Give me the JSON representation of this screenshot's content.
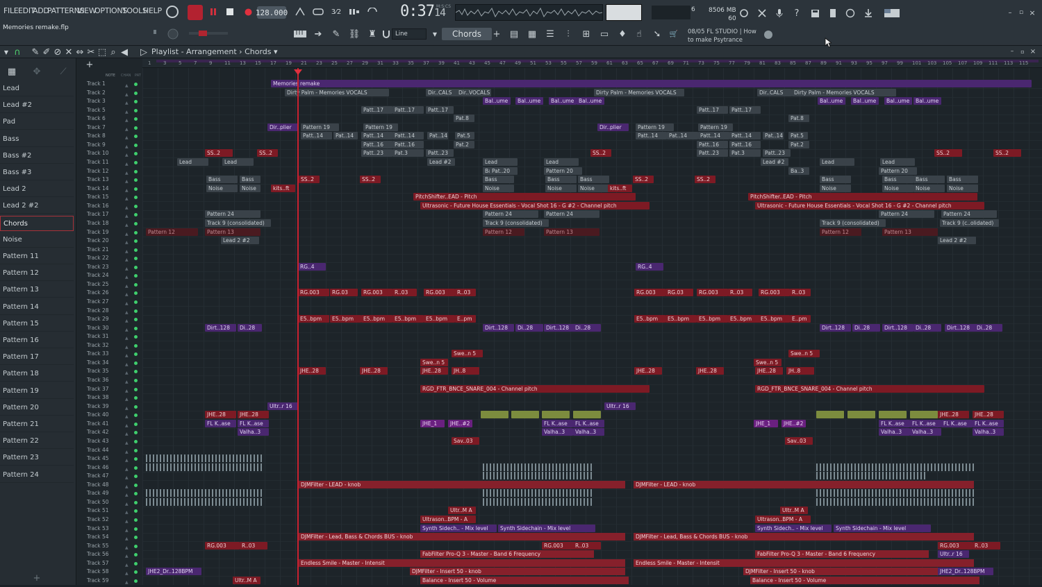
{
  "menu": [
    "FILE",
    "EDIT",
    "ADD",
    "PATTERNS",
    "VIEW",
    "OPTIONS",
    "TOOLS",
    "HELP"
  ],
  "transport": {
    "tempo": "128.000",
    "time": "0:37",
    "time_small": "14",
    "msc": "M:S:CS"
  },
  "monitor": {
    "cpu": "6",
    "memory": "8506 MB",
    "poly": "60"
  },
  "hint": {
    "line1": "08/05  FL STUDIO | How",
    "line2": "to make Psytrance"
  },
  "project": {
    "filename": "Memories remake.flp"
  },
  "toolbar": {
    "snap": "Line",
    "pattern": "Chords"
  },
  "playlist": {
    "breadcrumb": "Playlist - Arrangement",
    "current": "Chords"
  },
  "channels": [
    {
      "label": "Lead"
    },
    {
      "label": "Lead #2"
    },
    {
      "label": "Pad"
    },
    {
      "label": "Bass"
    },
    {
      "label": "Bass #2"
    },
    {
      "label": "Bass #3"
    },
    {
      "label": "Lead 2"
    },
    {
      "label": "Lead 2 #2"
    },
    {
      "label": "Chords"
    },
    {
      "label": "Noise"
    },
    {
      "label": "Pattern 11"
    },
    {
      "label": "Pattern 12"
    },
    {
      "label": "Pattern 13"
    },
    {
      "label": "Pattern 14"
    },
    {
      "label": "Pattern 15"
    },
    {
      "label": "Pattern 16"
    },
    {
      "label": "Pattern 17"
    },
    {
      "label": "Pattern 18"
    },
    {
      "label": "Pattern 19"
    },
    {
      "label": "Pattern 20"
    },
    {
      "label": "Pattern 21"
    },
    {
      "label": "Pattern 22"
    },
    {
      "label": "Pattern 23"
    },
    {
      "label": "Pattern 24"
    }
  ],
  "tracks": [
    "Track 1",
    "Track 2",
    "Track 3",
    "Track 5",
    "Track 6",
    "Track 7",
    "Track 8",
    "Track 9",
    "Track 10",
    "Track 11",
    "Track 12",
    "Track 13",
    "Track 14",
    "Track 15",
    "Track 16",
    "Track 17",
    "Track 18",
    "Track 19",
    "Track 20",
    "Track 21",
    "Track 22",
    "Track 23",
    "Track 24",
    "Track 25",
    "Track 26",
    "Track 27",
    "Track 28",
    "Track 29",
    "Track 30",
    "Track 31",
    "Track 32",
    "Track 33",
    "Track 34",
    "Track 35",
    "Track 36",
    "Track 37",
    "Track 38",
    "Track 39",
    "Track 40",
    "Track 41",
    "Track 42",
    "Track 43",
    "Track 44",
    "Track 45",
    "Track 46",
    "Track 47",
    "Track 48",
    "Track 49",
    "Track 50",
    "Track 51",
    "Track 52",
    "Track 53",
    "Track 54",
    "Track 55",
    "Track 56",
    "Track 57",
    "Track 58",
    "Track 59"
  ],
  "ruler": [
    "1",
    "3",
    "5",
    "7",
    "9",
    "11",
    "13",
    "15",
    "17",
    "19",
    "21",
    "23",
    "25",
    "27",
    "29",
    "31",
    "33",
    "35",
    "37",
    "39",
    "41",
    "43",
    "45",
    "47",
    "49",
    "51",
    "53",
    "55",
    "57",
    "59",
    "61",
    "63",
    "65",
    "67",
    "69",
    "71",
    "73",
    "75",
    "77",
    "79",
    "81",
    "83",
    "85",
    "87",
    "89",
    "91",
    "93",
    "95",
    "97",
    "99",
    "101",
    "103",
    "105",
    "107",
    "109",
    "111",
    "113",
    "115"
  ],
  "clips": {
    "memories": "Memories remake",
    "dirty_palm": "Dirty Palm - Memories VOCALS",
    "dir_cals": "Dir..CALS",
    "dir_vocals": "Dir..VOCALS",
    "dirty_palm2": "Dirty Palm - Memories VOCALS",
    "dir_cals2": "Dir..CALS",
    "dirty_palm3": "Dirty Palm - Memories VOCALS",
    "bal_ume": "Bal..ume",
    "patt17": "Patt..17",
    "pat8": "Pat.8",
    "pattern19": "Pattern 19",
    "dir_plier": "Dir..plier",
    "patt14": "Patt..14",
    "pat14": "Pat..14",
    "pat5": "Pat.5",
    "patt16": "Patt..16",
    "pat16": "Pat..16",
    "pat2": "Pat.2",
    "ss2": "SS..2",
    "patt23": "Patt..23",
    "pat3": "Pat.3",
    "lead": "Lead",
    "lead2": "Lead #2",
    "pattern20": "Pattern 20",
    "bass": "Bass",
    "ba3": "Ba..3",
    "pat20": "Pat..20",
    "noise": "Noise",
    "kits": "kits..ft",
    "pitch_shifter": "PitchShifter..EAD - Pitch",
    "ultrasonic": "Ultrasonic - Future House Essentials - Vocal Shot 16 - G #2 - Channel pitch",
    "pattern24": "Pattern 24",
    "track9": "Track 9 (consolidated)",
    "track9b": "Track 9 (c..olidated)",
    "pattern12": "Pattern 12",
    "pattern13": "Pattern 13",
    "lead22": "Lead 2 #2",
    "rg": "RG..4",
    "rg003": "RG.003",
    "rg03": "RG.03",
    "e5bpm": "E5..bpm",
    "epm": "E..pm",
    "dirt128": "Dirt..128",
    "di28": "Di..28",
    "swe": "Swe..n 5",
    "jhe28": "JHE..28",
    "jh8": "JH..8",
    "rgd": "RGD_FTR_BNCE_SNARE_004 - Channel pitch",
    "ultr16": "Ultr..r 16",
    "jhe1": "JHE_1",
    "jhe2": "JHE..#2",
    "flkase": "FL K..ase",
    "valha": "Valha..3",
    "sav03": "Sav..03",
    "djm_lead": "DJMFilter - LEAD - knob",
    "ultr_ma": "Ultr..M A",
    "ultrason_bpm": "Ultrason..BPM - A",
    "synth_side": "Synth Sidech.. - Mix level",
    "synth_side2": "Synth Sidechain - Mix level",
    "djm_bus": "DJMFilter - Lead, Bass & Chords BUS - knob",
    "fabfilter": "FabFilter Pro-Q 3 - Master - Band 6 Frequency",
    "endless": "Endless Smile - Master - Intensit",
    "djm_insert": "DJMFilter - Insert 50 - knob",
    "balance": "Balance - Insert 50 - Volume",
    "jhe2dr": "JHE2_Dr..128BPM",
    "rg003b": "RG.003",
    "r03": "R..03"
  },
  "colors": {
    "playhead": "#c82130",
    "clip_red": "#7d1a24",
    "clip_purple": "#4a2770",
    "mute_dot": "#3fcf6d"
  }
}
